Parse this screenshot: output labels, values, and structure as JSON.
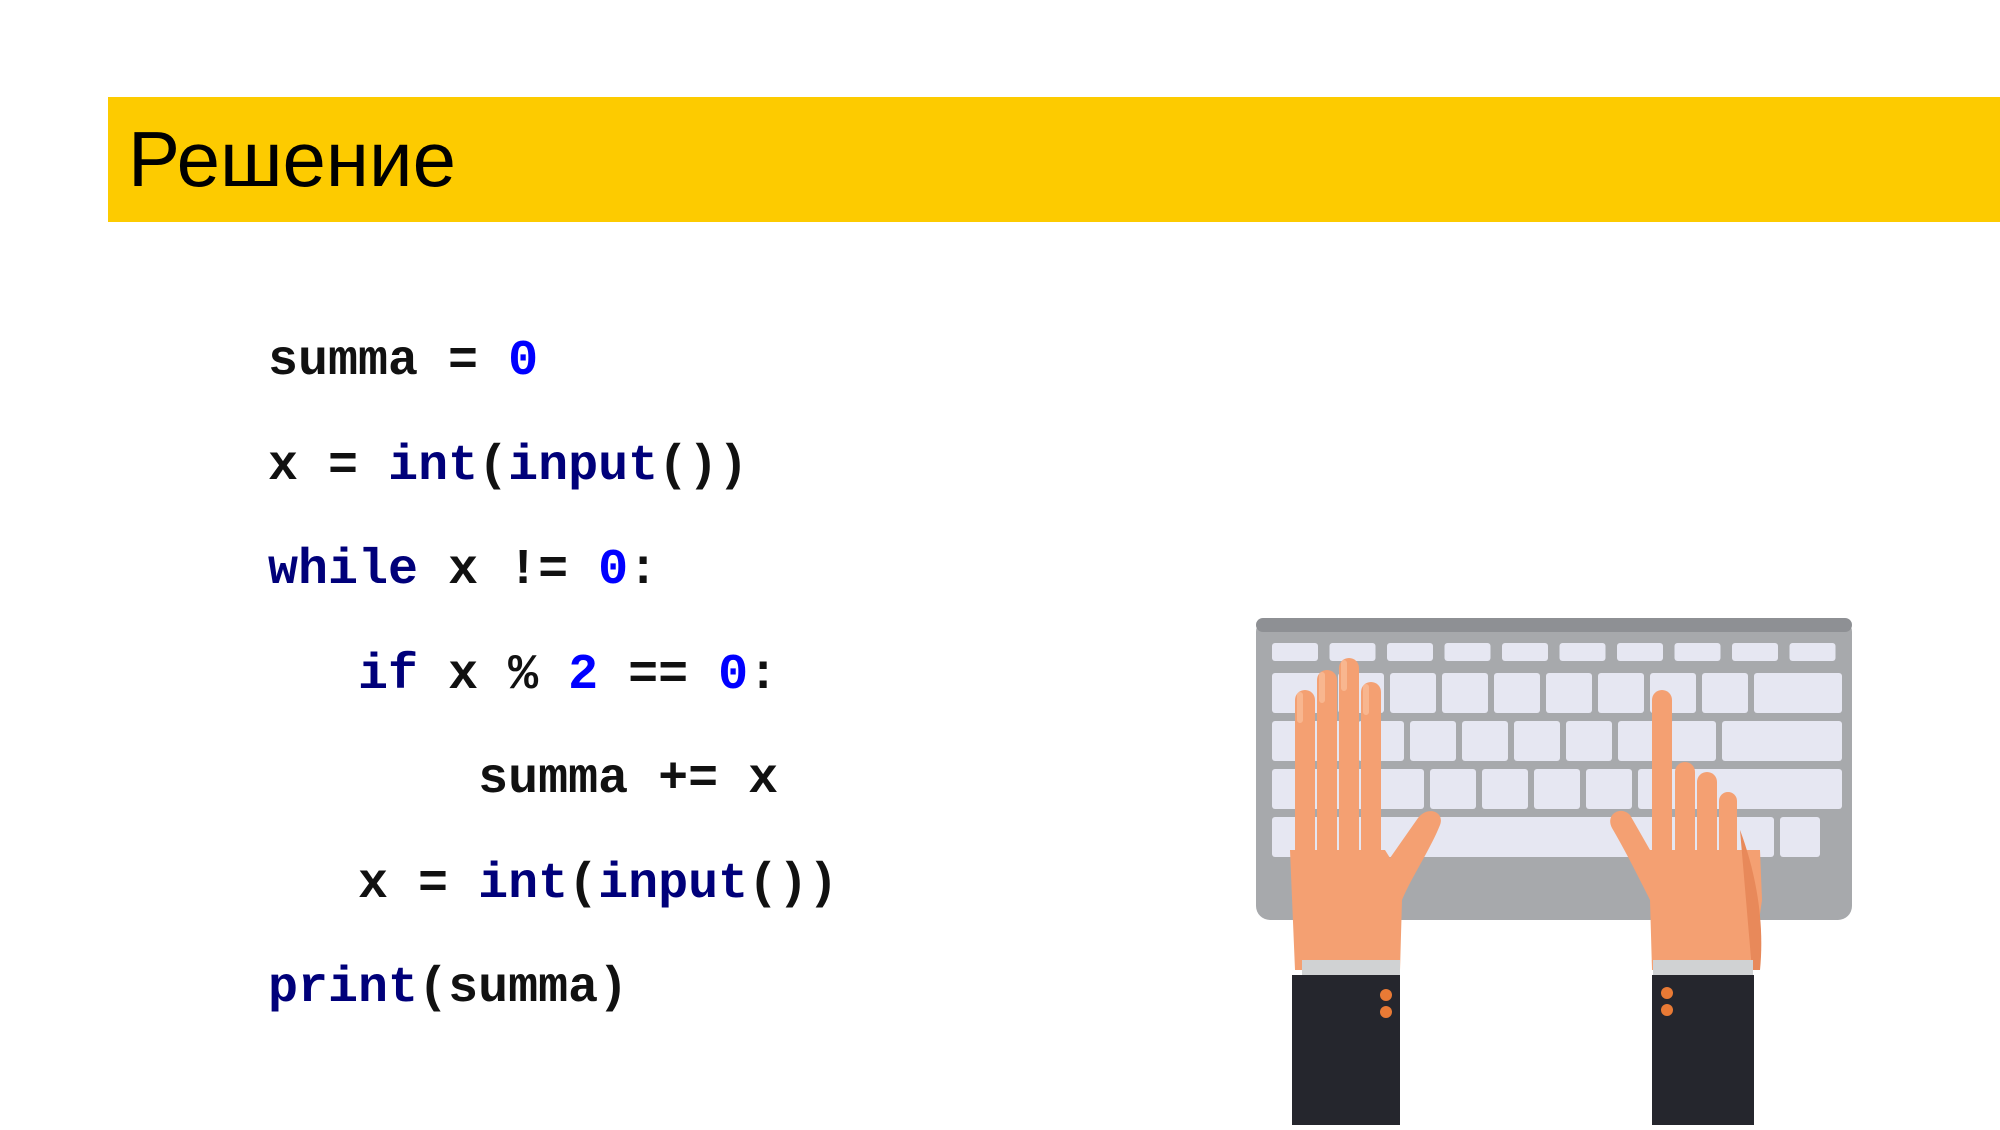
{
  "title": "Решение",
  "code_lines": [
    {
      "tokens": [
        {
          "text": "summa = ",
          "kind": "id"
        },
        {
          "text": "0",
          "kind": "num"
        }
      ]
    },
    {
      "tokens": [
        {
          "text": "x = ",
          "kind": "id"
        },
        {
          "text": "int",
          "kind": "kw"
        },
        {
          "text": "(",
          "kind": "id"
        },
        {
          "text": "input",
          "kind": "kw"
        },
        {
          "text": "())",
          "kind": "id"
        }
      ]
    },
    {
      "tokens": [
        {
          "text": "while",
          "kind": "kw"
        },
        {
          "text": " x != ",
          "kind": "id"
        },
        {
          "text": "0",
          "kind": "num"
        },
        {
          "text": ":",
          "kind": "id"
        }
      ]
    },
    {
      "tokens": [
        {
          "text": "   ",
          "kind": "id"
        },
        {
          "text": "if",
          "kind": "kw"
        },
        {
          "text": " x % ",
          "kind": "id"
        },
        {
          "text": "2",
          "kind": "num"
        },
        {
          "text": " == ",
          "kind": "id"
        },
        {
          "text": "0",
          "kind": "num"
        },
        {
          "text": ":",
          "kind": "id"
        }
      ]
    },
    {
      "tokens": [
        {
          "text": "       summa += x",
          "kind": "id"
        }
      ]
    },
    {
      "tokens": [
        {
          "text": "   x = ",
          "kind": "id"
        },
        {
          "text": "int",
          "kind": "kw"
        },
        {
          "text": "(",
          "kind": "id"
        },
        {
          "text": "input",
          "kind": "kw"
        },
        {
          "text": "())",
          "kind": "id"
        }
      ]
    },
    {
      "tokens": [
        {
          "text": "print",
          "kind": "kw"
        },
        {
          "text": "(summa)",
          "kind": "id"
        }
      ]
    }
  ],
  "illustration": {
    "name": "hands-typing-on-keyboard"
  },
  "colors": {
    "title_bar": "#fdcb00",
    "keyword": "#00007a",
    "number": "#0000ff",
    "skin": "#f4a072",
    "sleeve": "#25262d",
    "keyboard": "#a7a9ac"
  }
}
